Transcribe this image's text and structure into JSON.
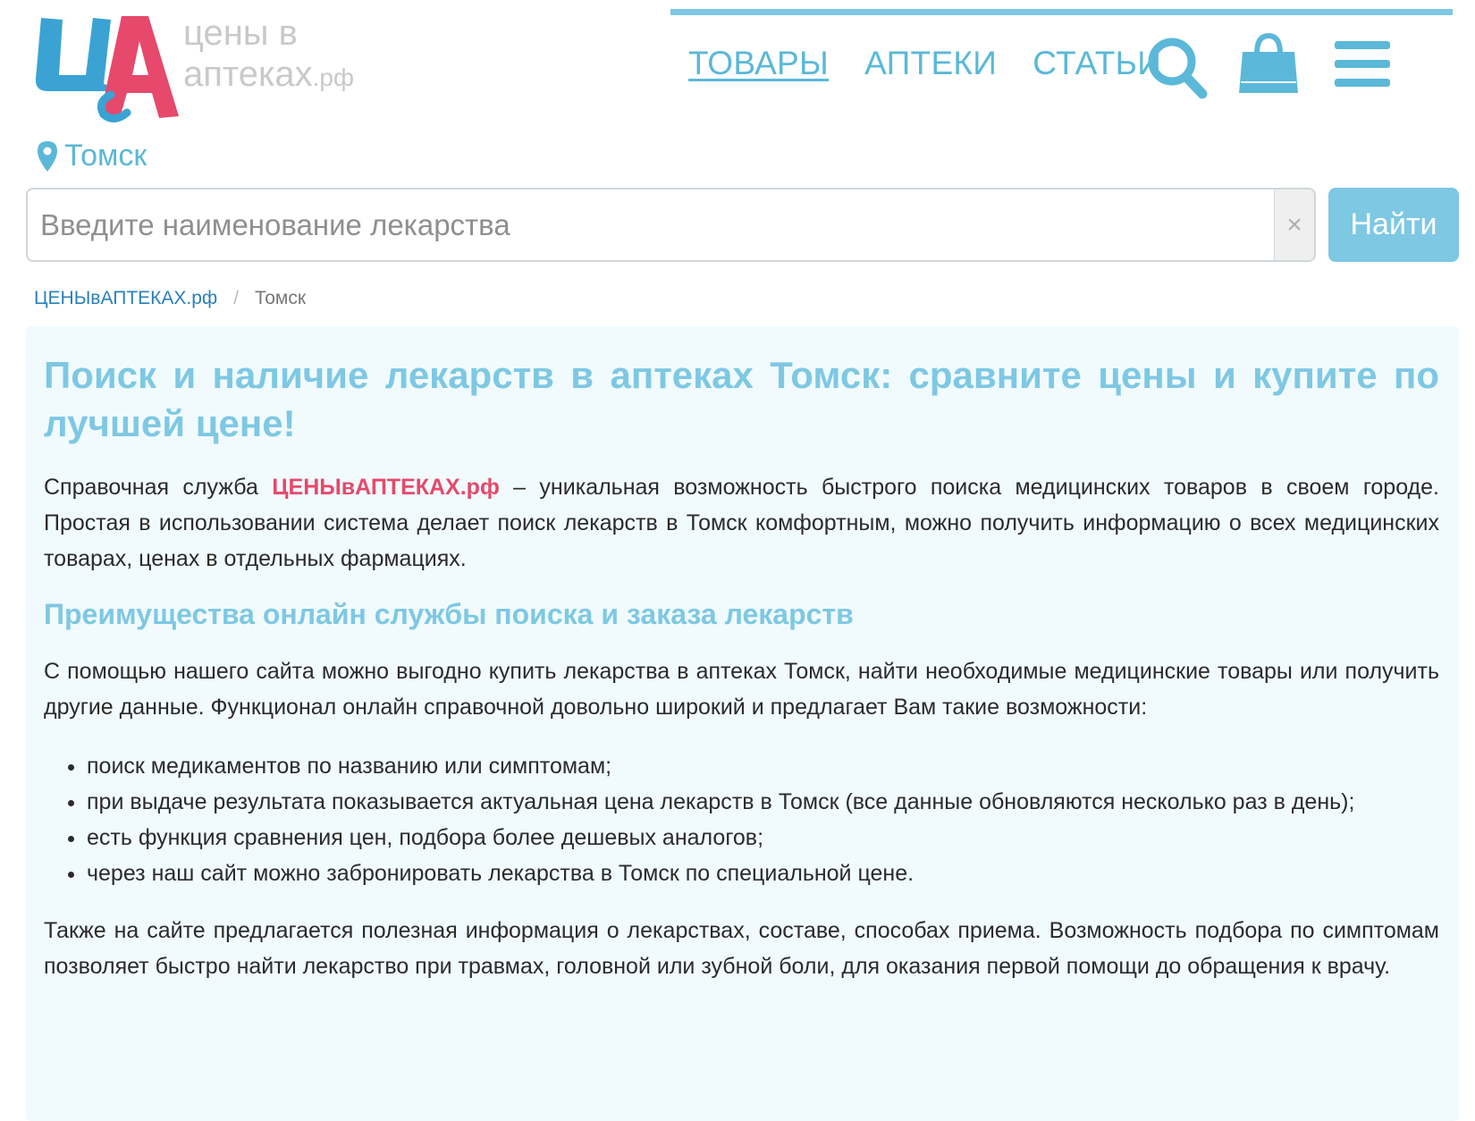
{
  "header": {
    "logo_line1": "цены в",
    "logo_line2": "аптеках",
    "logo_suffix": ".рф",
    "nav": [
      {
        "label": "ТОВАРЫ"
      },
      {
        "label": "АПТЕКИ"
      },
      {
        "label": "СТАТЬИ"
      }
    ],
    "icons": [
      "search-icon",
      "shopping-bag-icon",
      "menu-icon"
    ],
    "city": "Томск"
  },
  "search": {
    "placeholder": "Введите наименование лекарства",
    "value": "",
    "clear_label": "×",
    "button_label": "Найти"
  },
  "breadcrumb": {
    "home": "ЦЕНЫвАПТЕКАХ.рф",
    "separator": "/",
    "current": "Томск"
  },
  "content": {
    "title": "Поиск и наличие лекарств в аптеках Томск: сравните цены и купите по лучшей цене!",
    "intro_prefix": "Справочная служба ",
    "intro_brand": "ЦЕНЫвАПТЕКАХ.рф",
    "intro_suffix": " – уникальная возможность быстрого поиска медицинских товаров в своем городе. Простая в использовании система делает поиск лекарств в Томск комфортным, можно получить информацию о всех медицинских товарах, ценах в отдельных фармациях.",
    "subtitle": "Преимущества онлайн службы поиска и заказа лекарств",
    "para2": "С помощью нашего сайта можно выгодно купить лекарства в аптеках Томск, найти необходимые медицинские товары или получить другие данные. Функционал онлайн справочной довольно широкий и предлагает Вам такие возможности:",
    "list": [
      "поиск медикаментов по названию или симптомам;",
      "при выдаче результата показывается актуальная цена лекарств в Томск (все данные обновляются несколько раз в день);",
      "есть функция сравнения цен, подбора более дешевых аналогов;",
      "через наш сайт можно забронировать лекарства в Томск по специальной цене."
    ],
    "para3": "Также на сайте предлагается полезная информация о лекарствах, составе, способах приема. Возможность подбора по симптомам позволяет быстро найти лекарство при травмах, головной или зубной боли, для оказания первой помощи до обращения к врачу."
  },
  "colors": {
    "accent": "#7ec8e3",
    "link": "#2a80b9",
    "brand": "#e6496b",
    "panel_bg": "#f1fbfe"
  }
}
